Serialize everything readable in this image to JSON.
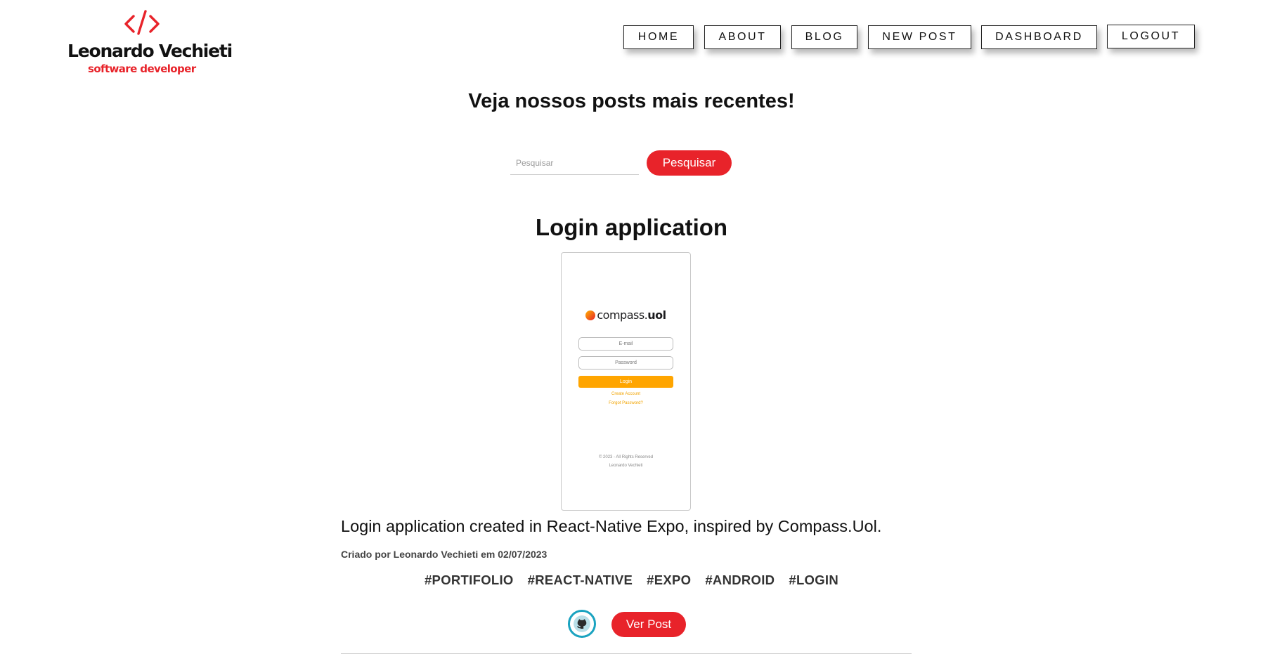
{
  "brand": {
    "name": "Leonardo Vechieti",
    "tagline": "software developer",
    "accent_color": "#e8232a",
    "icon": "code-brackets-icon"
  },
  "nav": {
    "home": "HOME",
    "about": "ABOUT",
    "blog": "BLOG",
    "new_post": "NEW POST",
    "dashboard": "DASHBOARD",
    "logout": "LOGOUT"
  },
  "headline": "Veja nossos posts mais recentes!",
  "search": {
    "placeholder": "Pesquisar",
    "value": "",
    "button_label": "Pesquisar"
  },
  "post": {
    "title": "Login application",
    "image": {
      "brand_prefix": "compass.",
      "brand_bold": "uol",
      "email_placeholder": "E-mail",
      "password_placeholder": "Password",
      "login_button": "Login",
      "create_account": "Create Account",
      "forgot_password": "Forgot Password?",
      "footer_line1": "© 2023 - All Rights Reserved",
      "footer_line2": "Leonardo Vechieti",
      "button_color": "#ffa500"
    },
    "description": "Login application created in React-Native Expo, inspired by Compass.Uol.",
    "meta": "Criado por Leonardo Vechieti em 02/07/2023",
    "tags": [
      "#PORTIFOLIO",
      "#REACT-NATIVE",
      "#EXPO",
      "#ANDROID",
      "#LOGIN"
    ],
    "github_icon": "github-icon",
    "github_ring_color": "#1aa3c0",
    "view_button": "Ver Post"
  }
}
